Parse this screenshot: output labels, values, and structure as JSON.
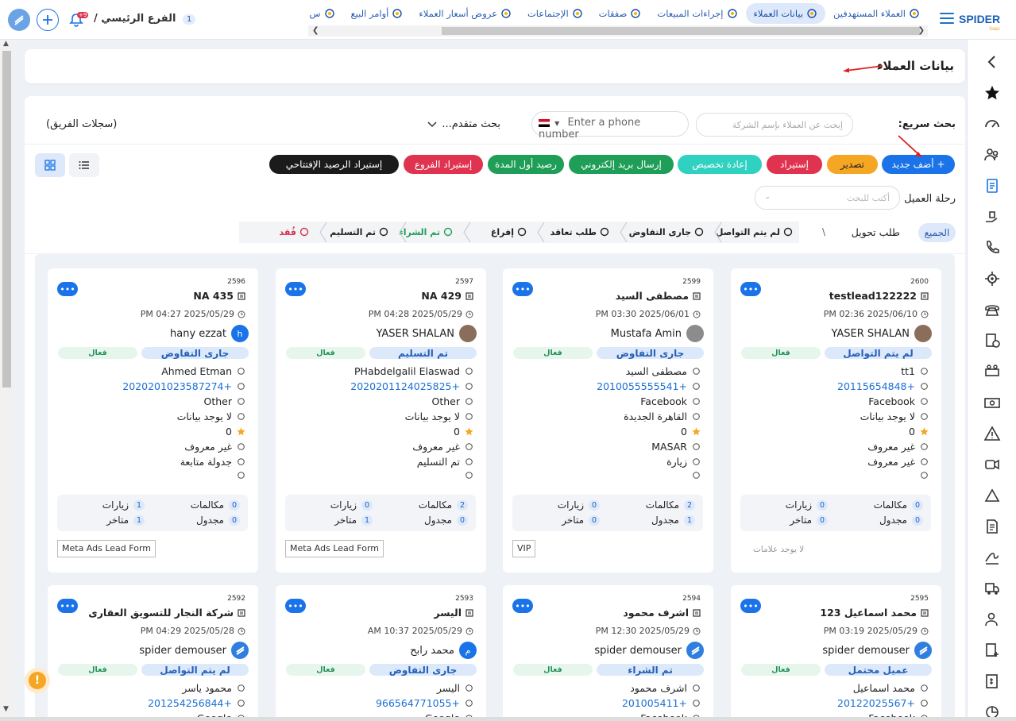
{
  "topbar": {
    "logo_text": "SPIDER",
    "logo_sub": "Saas",
    "tabs": [
      {
        "label": "العملاء المستهدفين",
        "icon": "people-icon",
        "active": false
      },
      {
        "label": "بيانات العملاء",
        "icon": "target-icon",
        "active": true
      },
      {
        "label": "إجراءات المبيعات",
        "icon": "badge-icon",
        "active": false
      },
      {
        "label": "صفقات",
        "icon": "team-icon",
        "active": false
      },
      {
        "label": "الإجتماعات",
        "icon": "presentation-icon",
        "active": false
      },
      {
        "label": "عروض أسعار العملاء",
        "icon": "quote-icon",
        "active": false
      },
      {
        "label": "أوامر البيع",
        "icon": "money-bag-icon",
        "active": false
      },
      {
        "label": "س",
        "icon": "misc-icon",
        "active": false
      }
    ],
    "branch": "الفرع الرئيسي /",
    "branch_count": "1",
    "notif_count": "+9"
  },
  "page": {
    "title": "بيانات العملاء"
  },
  "filters": {
    "quick_search_label": "بحث سريع:",
    "company_search_placeholder": "إبحث عن العملاء بإسم الشركة",
    "phone_placeholder": "Enter a phone number",
    "advanced_search": "بحث متقدم...",
    "team_records": "(سجلات الفريق)",
    "journey_label": "رحلة العميل",
    "journey_placeholder": "أكتب للبحث"
  },
  "actions": [
    {
      "label": "+ أضف جديد",
      "color": "#1a73e8"
    },
    {
      "label": "تصدير",
      "color": "#f5a623"
    },
    {
      "label": "إستيراد",
      "color": "#e0334f"
    },
    {
      "label": "إعادة تخصيص",
      "color": "#2fd1c0"
    },
    {
      "label": "إرسال بريد إلكتروني",
      "color": "#1e9e57"
    },
    {
      "label": "رصيد أول المدة",
      "color": "#1e9e57"
    },
    {
      "label": "إستيراد الفروع",
      "color": "#e0334f"
    },
    {
      "label": "إستيراد الرصيد الإفتتاحي",
      "color": "#1b1b1b"
    }
  ],
  "pipeline": {
    "all": "الجميع",
    "conversion_request": "طلب تحويل",
    "separator": "\\",
    "stages": [
      {
        "label": "لم يتم التواصل",
        "color": "#222"
      },
      {
        "label": "جارى التفاوض",
        "color": "#222"
      },
      {
        "label": "طلب تعاقد",
        "color": "#222"
      },
      {
        "label": "إفراغ",
        "color": "#222"
      },
      {
        "label": "تم الشراء",
        "color": "#1e9e57"
      },
      {
        "label": "تم التسليم",
        "color": "#222"
      },
      {
        "label": "فُقد",
        "color": "#d0334a"
      }
    ]
  },
  "cards": [
    {
      "id": "2600",
      "title": "testlead122222",
      "date": "2025/06/10 02:36 PM",
      "user": "YASER SHALAN",
      "avatar": "photo",
      "avatar_color": "#8a6d5a",
      "status": "لم يتم التواصل",
      "activity": "فعال",
      "contact": "tt1",
      "phone": "+20115654848",
      "source": "Facebook",
      "location": "لا يوجد بيانات",
      "rating": "0",
      "channel": "غير معروف",
      "next": "غير معروف",
      "calls": "0",
      "visits": "0",
      "scheduled": "0",
      "late": "0",
      "tag": "",
      "no_tag": "لا يوجد علامات"
    },
    {
      "id": "2599",
      "title": "مصطفى السيد",
      "date": "2025/06/01 03:30 PM",
      "user": "Mustafa Amin",
      "avatar": "photo",
      "avatar_color": "#8c8c8c",
      "status": "جارى التفاوض",
      "activity": "فعال",
      "contact": "مصطفى السيد",
      "phone": "+2010055555541",
      "source": "Facebook",
      "location": "القاهرة الجديدة",
      "rating": "0",
      "channel": "MASAR",
      "next": "زيارة",
      "calls": "2",
      "visits": "0",
      "scheduled": "1",
      "late": "0",
      "tag": "VIP",
      "no_tag": ""
    },
    {
      "id": "2597",
      "title": "NA 429",
      "date": "2025/05/29 04:28 PM",
      "user": "YASER SHALAN",
      "avatar": "photo",
      "avatar_color": "#8a6d5a",
      "status": "تم التسليم",
      "activity": "فعال",
      "contact": "PHabdelgalil Elaswad",
      "phone": "+2020201124025825",
      "source": "Other",
      "location": "لا يوجد بيانات",
      "rating": "0",
      "channel": "غير معروف",
      "next": "تم التسليم",
      "calls": "2",
      "visits": "0",
      "scheduled": "0",
      "late": "1",
      "tag": "Meta Ads Lead Form",
      "no_tag": ""
    },
    {
      "id": "2596",
      "title": "NA 435",
      "date": "2025/05/29 04:27 PM",
      "user": "hany ezzat",
      "avatar": "h",
      "avatar_color": "#1a73e8",
      "status": "جارى التفاوض",
      "activity": "فعال",
      "contact": "Ahmed Etman",
      "phone": "+2020201023587274",
      "source": "Other",
      "location": "لا يوجد بيانات",
      "rating": "0",
      "channel": "غير معروف",
      "next": "جدولة متابعة",
      "calls": "0",
      "visits": "1",
      "scheduled": "0",
      "late": "1",
      "tag": "Meta Ads Lead Form",
      "no_tag": ""
    },
    {
      "id": "2595",
      "title": "محمد اسماعيل 123",
      "date": "2025/05/29 03:19 PM",
      "user": "spider demouser",
      "avatar": "logo",
      "avatar_color": "#2f7fe0",
      "status": "عميل محتمل",
      "activity": "فعال",
      "contact": "محمد اسماعيل",
      "phone": "+20122025567",
      "source": "Facebook"
    },
    {
      "id": "2594",
      "title": "اشرف محمود",
      "date": "2025/05/29 12:30 PM",
      "user": "spider demouser",
      "avatar": "logo",
      "avatar_color": "#2f7fe0",
      "status": "تم الشراء",
      "activity": "فعال",
      "contact": "اشرف محمود",
      "phone": "+201005411",
      "source": "Facebook"
    },
    {
      "id": "2593",
      "title": "اليسر",
      "date": "2025/05/29 10:37 AM",
      "user": "محمد رابح",
      "avatar": "م",
      "avatar_color": "#1a73e8",
      "status": "جارى التفاوض",
      "activity": "فعال",
      "contact": "اليسر",
      "phone": "+966564771055",
      "source": "Google"
    },
    {
      "id": "2592",
      "title": "شركة النجار للتسويق العقارى",
      "date": "2025/05/28 04:29 PM",
      "user": "spider demouser",
      "avatar": "logo",
      "avatar_color": "#2f7fe0",
      "status": "لم يتم التواصل",
      "activity": "فعال",
      "contact": "محمود ياسر",
      "phone": "+201254256844",
      "source": "Google"
    }
  ],
  "labels": {
    "calls": "مكالمات",
    "visits": "زيارات",
    "scheduled": "مجدول",
    "late": "متاخر"
  }
}
